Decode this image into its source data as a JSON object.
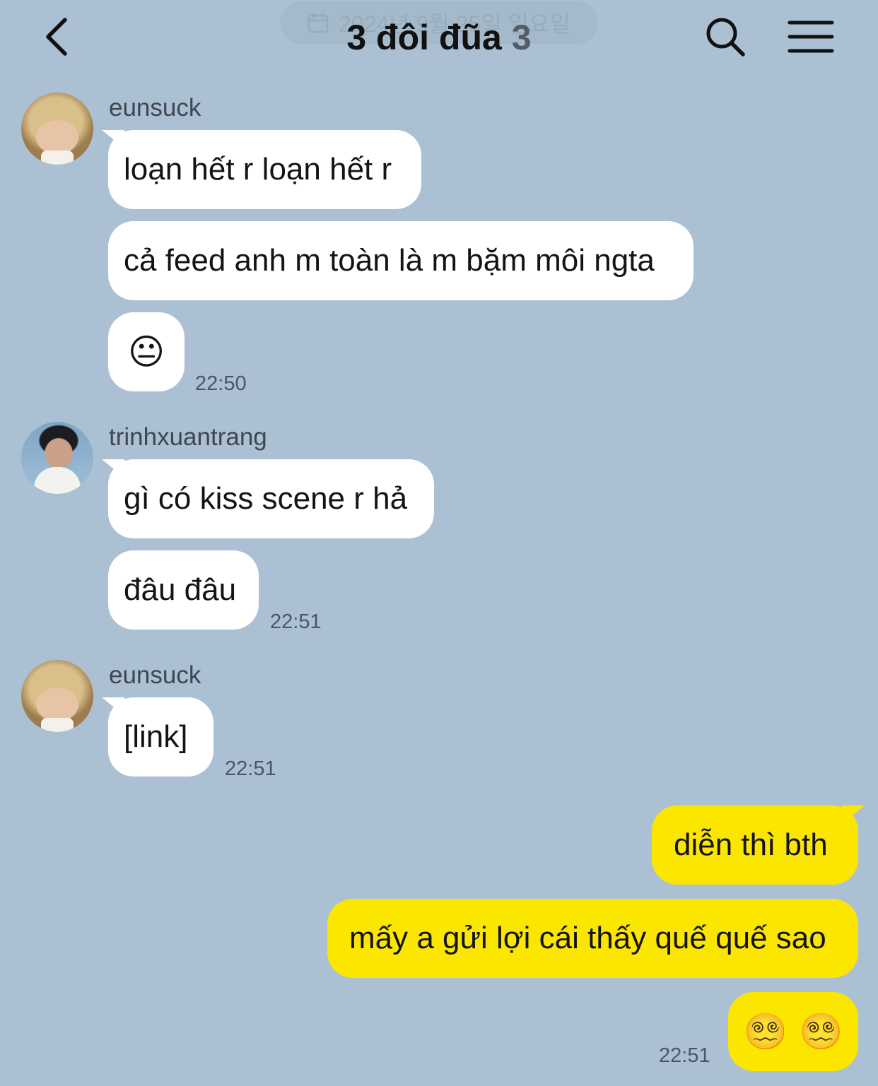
{
  "header": {
    "date_pill": "2024년 9월 25일 일요일",
    "title": "3 đôi đũa",
    "member_count": "3"
  },
  "messages": [
    {
      "sender": "eunsuck",
      "avatar": "blond-hair-avatar",
      "bubbles": [
        "loạn hết r loạn hết r",
        "cả feed anh m toàn là m bặm môi ngta",
        "😐"
      ],
      "time": "22:50"
    },
    {
      "sender": "trinhxuantrang",
      "avatar": "dark-hair-avatar",
      "bubbles": [
        "gì có kiss scene r hả",
        "đâu đâu"
      ],
      "time": "22:51"
    },
    {
      "sender": "eunsuck",
      "avatar": "blond-hair-avatar",
      "bubbles": [
        "[link]"
      ],
      "time": "22:51"
    },
    {
      "sender": "me",
      "bubbles": [
        "diễn thì bth",
        "mấy a gửi lợi cái thấy quế quế sao",
        "😵‍💫 😵‍💫"
      ],
      "time": "22:51"
    }
  ],
  "colors": {
    "background": "#abc1d3",
    "incoming_bubble": "#ffffff",
    "outgoing_bubble": "#fbe600"
  },
  "icons": [
    "back-arrow-icon",
    "search-icon",
    "menu-icon",
    "calendar-icon",
    "neutral-face-emoji",
    "dizzy-face-emoji"
  ]
}
